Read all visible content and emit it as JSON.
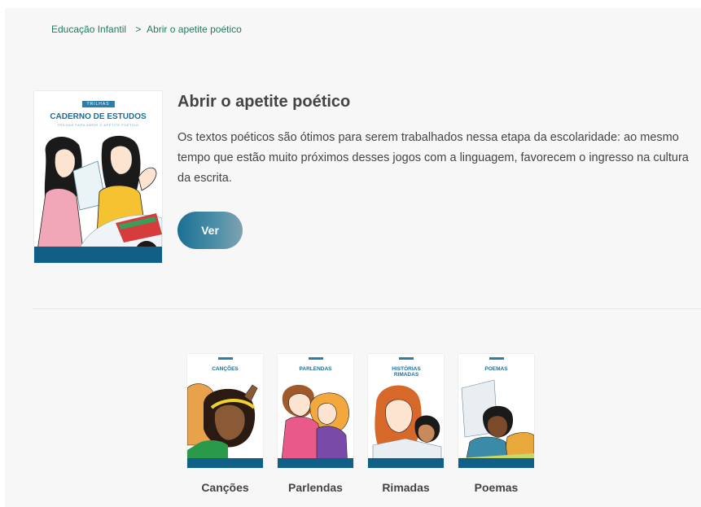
{
  "breadcrumb": {
    "root": "Educação Infantil",
    "separator": ">",
    "current": "Abrir o apetite poético"
  },
  "hero": {
    "cover": {
      "tag": "TRILHAS",
      "title": "CADERNO DE ESTUDOS",
      "subtitle": "TRILHAS PARA ABRIR O APETITE POÉTICO"
    },
    "title": "Abrir o apetite poético",
    "description": "Os textos poéticos são ótimos para serem trabalhados nessa etapa da escolaridade: ao mesmo tempo que estão muito próximos desses jogos com a linguagem, favorecem o ingresso na cultura da escrita.",
    "button_label": "Ver"
  },
  "books": [
    {
      "cover_title": "CANÇÕES",
      "label": "Canções"
    },
    {
      "cover_title": "PARLENDAS",
      "label": "Parlendas"
    },
    {
      "cover_title": "HISTÓRIAS RIMADAS",
      "label": "Rimadas"
    },
    {
      "cover_title": "POEMAS",
      "label": "Poemas"
    }
  ],
  "colors": {
    "accent": "#1e7b63",
    "cover_blue": "#0f5f87",
    "text": "#444444",
    "background": "#f7f7f7"
  }
}
